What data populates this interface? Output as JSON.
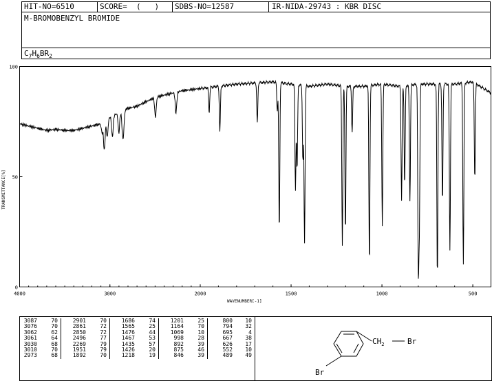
{
  "header": {
    "hit_no": "HIT-NO=6510",
    "score": "SCORE=  (   )",
    "sdbs_no": "SDBS-NO=12587",
    "ir_nida": "IR-NIDA-29743 : KBR DISC",
    "compound_name": "M-BROMOBENZYL BROMIDE",
    "formula": {
      "c": "C",
      "c_n": "7",
      "h": "H",
      "h_n": "6",
      "br": "BR",
      "br_n": "2"
    }
  },
  "chart_data": {
    "type": "line",
    "xlabel": "WAVENUMBER[-1]",
    "ylabel": "TRANSMITTANCE[%]",
    "xlim": [
      4000,
      400
    ],
    "ylim": [
      0,
      100
    ],
    "x_ticks": [
      "4000",
      "3000",
      "2000",
      "1500",
      "1000",
      "500"
    ],
    "y_ticks": [
      "100",
      "50",
      "0"
    ],
    "baseline": [
      [
        4000,
        74
      ],
      [
        3900,
        73
      ],
      [
        3800,
        72
      ],
      [
        3700,
        71
      ],
      [
        3600,
        71.5
      ],
      [
        3500,
        71
      ],
      [
        3400,
        71
      ],
      [
        3300,
        72
      ],
      [
        3200,
        73
      ],
      [
        3100,
        74
      ],
      [
        3000,
        77
      ],
      [
        2900,
        79
      ],
      [
        2800,
        81
      ],
      [
        2700,
        82
      ],
      [
        2600,
        84
      ],
      [
        2500,
        86
      ],
      [
        2400,
        87
      ],
      [
        2300,
        88
      ],
      [
        2200,
        89
      ],
      [
        2100,
        89.5
      ],
      [
        2000,
        90
      ],
      [
        1900,
        91
      ],
      [
        1800,
        92
      ],
      [
        1700,
        92.5
      ],
      [
        1600,
        93
      ],
      [
        1500,
        92
      ],
      [
        1400,
        91
      ],
      [
        1300,
        92
      ],
      [
        1200,
        91
      ],
      [
        1100,
        91
      ],
      [
        1000,
        92
      ],
      [
        900,
        91
      ],
      [
        800,
        92
      ],
      [
        700,
        92
      ],
      [
        600,
        92
      ],
      [
        500,
        93
      ],
      [
        400,
        88
      ]
    ],
    "peaks": [
      [
        3087,
        70
      ],
      [
        3062,
        62
      ],
      [
        3030,
        68
      ],
      [
        2973,
        68
      ],
      [
        2901,
        70
      ],
      [
        2861,
        72
      ],
      [
        2850,
        72
      ],
      [
        2496,
        77
      ],
      [
        2269,
        79
      ],
      [
        1951,
        79
      ],
      [
        1892,
        70
      ],
      [
        1686,
        74
      ],
      [
        1576,
        80
      ],
      [
        1565,
        25
      ],
      [
        1476,
        44
      ],
      [
        1467,
        53
      ],
      [
        1435,
        57
      ],
      [
        1426,
        20
      ],
      [
        1218,
        19
      ],
      [
        1201,
        25
      ],
      [
        1164,
        70
      ],
      [
        1069,
        10
      ],
      [
        998,
        28
      ],
      [
        892,
        39
      ],
      [
        875,
        46
      ],
      [
        846,
        39
      ],
      [
        800,
        10
      ],
      [
        794,
        32
      ],
      [
        695,
        4
      ],
      [
        667,
        38
      ],
      [
        626,
        17
      ],
      [
        552,
        10
      ],
      [
        489,
        49
      ]
    ]
  },
  "peak_table": [
    [
      "3087",
      "70",
      "2901",
      "70",
      "1686",
      "74",
      "1201",
      "25",
      "800",
      "10"
    ],
    [
      "3076",
      "70",
      "2861",
      "72",
      "1565",
      "25",
      "1164",
      "70",
      "794",
      "32"
    ],
    [
      "3062",
      "62",
      "2850",
      "72",
      "1476",
      "44",
      "1069",
      "10",
      "695",
      "4"
    ],
    [
      "3061",
      "64",
      "2496",
      "77",
      "1467",
      "53",
      "998",
      "28",
      "667",
      "38"
    ],
    [
      "3030",
      "68",
      "2269",
      "79",
      "1435",
      "57",
      "892",
      "39",
      "626",
      "17"
    ],
    [
      "3010",
      "70",
      "1951",
      "79",
      "1426",
      "20",
      "875",
      "46",
      "552",
      "10"
    ],
    [
      "2973",
      "68",
      "1892",
      "70",
      "1218",
      "19",
      "846",
      "39",
      "489",
      "49"
    ]
  ],
  "structure": {
    "ch2_label_c": "CH",
    "ch2_label_n": "2",
    "br_sub": "Br",
    "br_ring": "Br"
  }
}
